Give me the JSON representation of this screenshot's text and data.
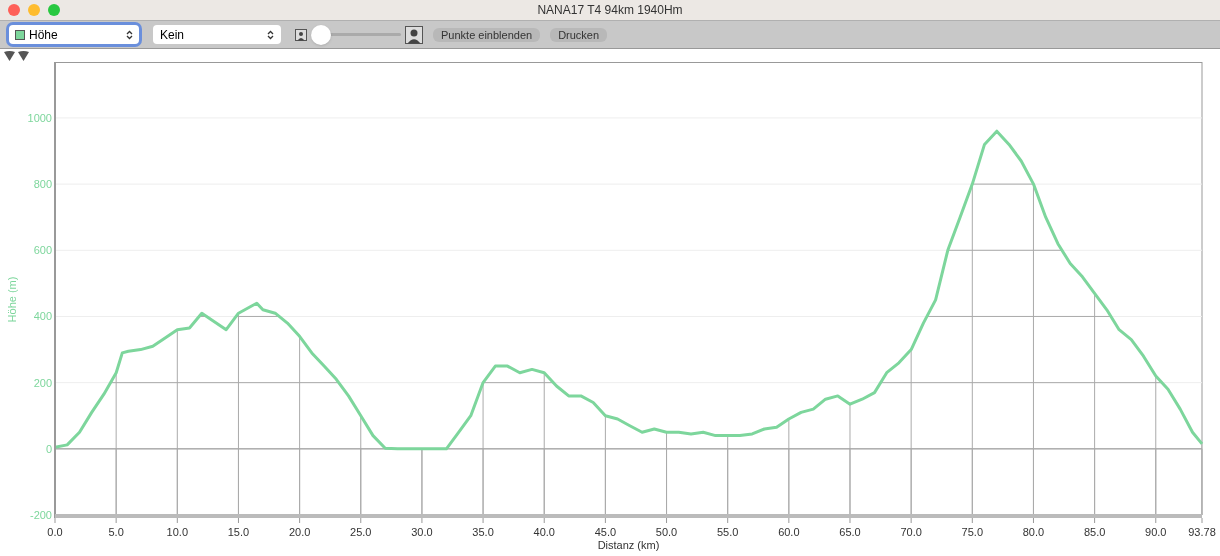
{
  "window": {
    "title": "NANA17 T4 94km 1940Hm"
  },
  "toolbar": {
    "metric_select": {
      "value": "Höhe",
      "color": "#7dd69c"
    },
    "overlay_select": {
      "value": "Kein"
    },
    "zoom_slider": {
      "level": 0.0
    },
    "buttons": [
      "Punkte einblenden",
      "Drucken"
    ]
  },
  "chart": {
    "chart_data": {
      "type": "line",
      "xlabel": "Distanz (km)",
      "ylabel": "Höhe (m)",
      "xlim": [
        0,
        93.78
      ],
      "ylim": [
        -200,
        1163
      ],
      "xticks": [
        {
          "value": 0,
          "label": "0.0"
        },
        {
          "value": 5,
          "label": "5.0"
        },
        {
          "value": 10,
          "label": "10.0"
        },
        {
          "value": 15,
          "label": "15.0"
        },
        {
          "value": 20,
          "label": "20.0"
        },
        {
          "value": 25,
          "label": "25.0"
        },
        {
          "value": 30,
          "label": "30.0"
        },
        {
          "value": 35,
          "label": "35.0"
        },
        {
          "value": 40,
          "label": "40.0"
        },
        {
          "value": 45,
          "label": "45.0"
        },
        {
          "value": 50,
          "label": "50.0"
        },
        {
          "value": 55,
          "label": "55.0"
        },
        {
          "value": 60,
          "label": "60.0"
        },
        {
          "value": 65,
          "label": "65.0"
        },
        {
          "value": 70,
          "label": "70.0"
        },
        {
          "value": 75,
          "label": "75.0"
        },
        {
          "value": 80,
          "label": "80.0"
        },
        {
          "value": 85,
          "label": "85.0"
        },
        {
          "value": 90,
          "label": "90.0"
        },
        {
          "value": 93.78,
          "label": "93.78"
        }
      ],
      "yticks": [
        -200,
        0,
        200,
        400,
        600,
        800,
        1000
      ],
      "grid": true,
      "x": [
        0,
        1,
        2,
        3,
        4,
        5,
        5.5,
        6,
        7,
        8,
        9,
        10,
        11,
        12,
        13,
        14,
        15,
        16,
        16.5,
        17,
        18,
        19,
        20,
        21,
        22,
        23,
        24,
        25,
        26,
        27,
        28,
        30,
        32,
        33,
        34,
        35,
        36,
        37,
        38,
        39,
        40,
        41,
        42,
        43,
        44,
        45,
        46,
        47,
        48,
        49,
        50,
        51,
        52,
        53,
        54,
        55,
        56,
        57,
        58,
        59,
        60,
        61,
        62,
        63,
        64,
        65,
        66,
        67,
        68,
        69,
        70,
        71,
        72,
        73,
        74,
        75,
        76,
        77,
        78,
        79,
        80,
        81,
        82,
        83,
        84,
        85,
        86,
        87,
        88,
        89,
        90,
        91,
        92,
        93,
        93.78
      ],
      "series": [
        {
          "color": "#7dd69c",
          "values": [
            5,
            12,
            50,
            110,
            165,
            230,
            290,
            295,
            300,
            310,
            335,
            360,
            365,
            410,
            385,
            360,
            410,
            430,
            440,
            420,
            410,
            380,
            340,
            290,
            250,
            210,
            160,
            100,
            40,
            2,
            0,
            0,
            0,
            50,
            100,
            200,
            250,
            250,
            230,
            240,
            230,
            190,
            160,
            160,
            140,
            100,
            90,
            70,
            50,
            60,
            50,
            50,
            45,
            50,
            40,
            40,
            40,
            45,
            60,
            65,
            90,
            110,
            120,
            150,
            160,
            135,
            150,
            170,
            230,
            260,
            300,
            380,
            450,
            600,
            700,
            800,
            920,
            960,
            920,
            870,
            800,
            700,
            620,
            560,
            520,
            470,
            420,
            360,
            330,
            280,
            220,
            180,
            120,
            50,
            15
          ]
        }
      ]
    }
  }
}
